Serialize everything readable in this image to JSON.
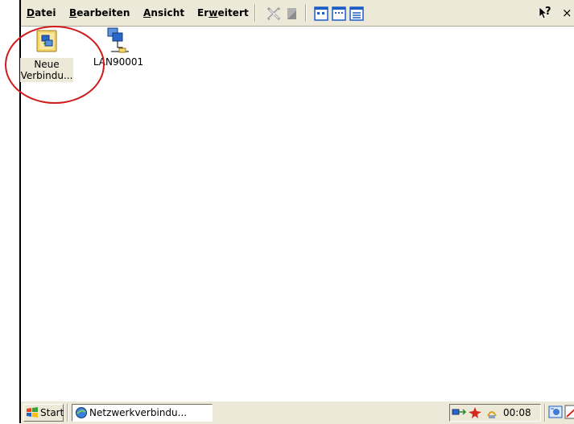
{
  "menubar": {
    "items": [
      {
        "label": "Datei",
        "accel_index": 0
      },
      {
        "label": "Bearbeiten",
        "accel_index": 0
      },
      {
        "label": "Ansicht",
        "accel_index": 0
      },
      {
        "label": "Erweitert",
        "accel_index": 2
      }
    ],
    "help_label": "?",
    "close_label": "×"
  },
  "toolbar": {
    "icons": [
      "delete-icon",
      "properties-icon",
      "large-icons-view-icon",
      "small-icons-view-icon",
      "details-view-icon"
    ]
  },
  "desktop": {
    "icons": [
      {
        "label_line1": "Neue",
        "label_line2": "Verbindu...",
        "icon": "new-connection-icon"
      },
      {
        "label_line1": "LAN90001",
        "icon": "lan-connection-icon"
      }
    ]
  },
  "taskbar": {
    "start_label": "Start",
    "task_label": "Netzwerkverbindu...",
    "clock": "00:08",
    "tray_icons": [
      "network-tray-icon",
      "status-tray-icon",
      "power-tray-icon"
    ],
    "extra_icons": [
      "desktop-icon",
      "input-panel-icon"
    ]
  },
  "colors": {
    "window": "#ffffff",
    "chrome": "#ece9d8",
    "annotation": "#d11b1b"
  }
}
